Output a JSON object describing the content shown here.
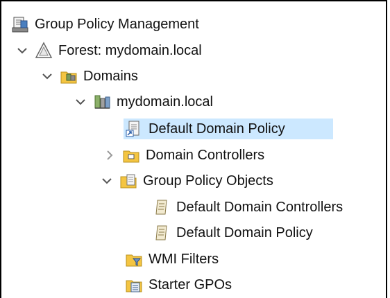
{
  "tree": {
    "root": {
      "label": "Group Policy Management",
      "icon": "gpm-console-icon"
    },
    "forest": {
      "label": "Forest: mydomain.local",
      "icon": "forest-icon",
      "expanded": true
    },
    "domains": {
      "label": "Domains",
      "icon": "domains-folder-icon",
      "expanded": true
    },
    "domain": {
      "label": "mydomain.local",
      "icon": "domain-icon",
      "expanded": true
    },
    "ddp_link": {
      "label": "Default Domain Policy",
      "icon": "gpo-link-icon",
      "selected": true
    },
    "domain_controllers": {
      "label": "Domain Controllers",
      "icon": "ou-folder-icon",
      "expanded": false
    },
    "gpo_container": {
      "label": "Group Policy Objects",
      "icon": "gpo-folder-icon",
      "expanded": true
    },
    "gpo_ddc": {
      "label": "Default Domain Controllers",
      "icon": "gpo-icon"
    },
    "gpo_ddp": {
      "label": "Default Domain Policy",
      "icon": "gpo-icon"
    },
    "wmi_filters": {
      "label": "WMI Filters",
      "icon": "wmi-filter-folder-icon"
    },
    "starter_gpos": {
      "label": "Starter GPOs",
      "icon": "starter-gpo-folder-icon"
    }
  },
  "colors": {
    "selection": "#cce8ff",
    "folder": "#f4c542",
    "chevron": "#555555"
  }
}
